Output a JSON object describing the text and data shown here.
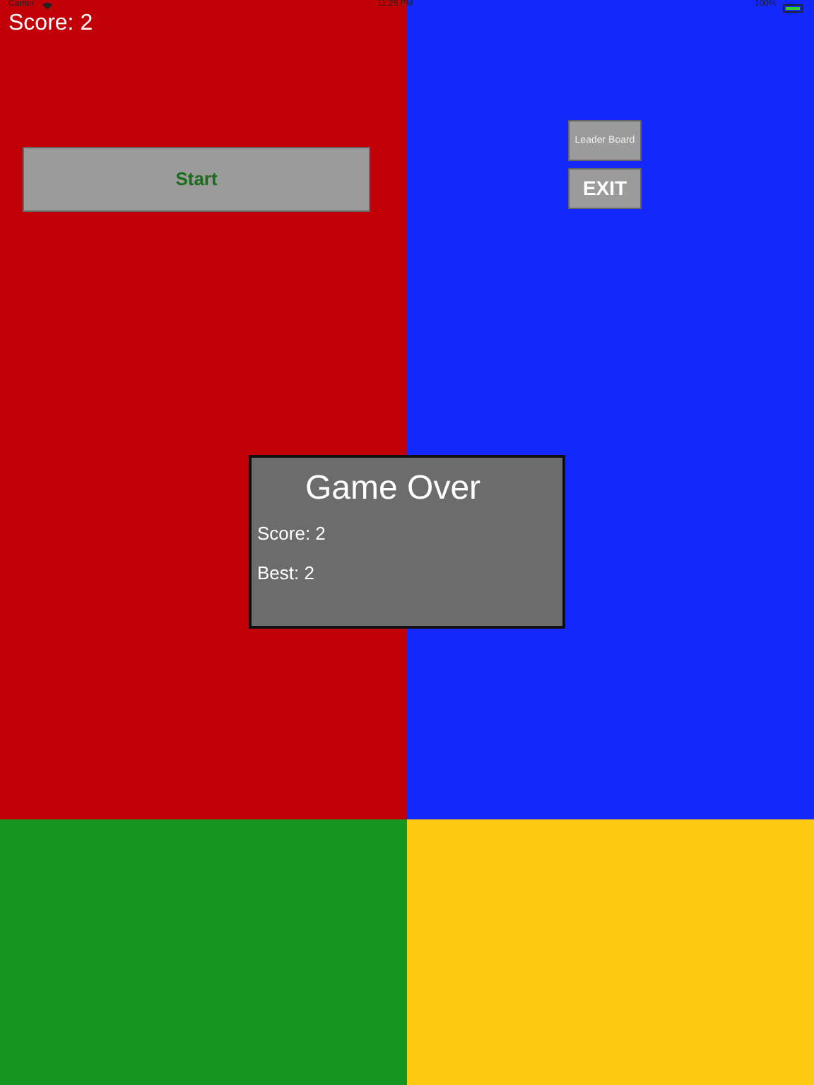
{
  "status_bar": {
    "carrier": "Carrier",
    "time": "11:28 PM",
    "battery": "100%"
  },
  "score": "Score: 2",
  "tiles": [
    {
      "color": "#c20008"
    },
    {
      "color": "#1428fb"
    },
    {
      "color": "#18951f"
    },
    {
      "color": "#fdca12"
    }
  ],
  "start_button": "Start",
  "leaderboard_button": "Leader Board",
  "exit_button": "EXIT",
  "game_over": {
    "title": "Game Over",
    "score": "Score: 2",
    "best": "Best: 2"
  }
}
